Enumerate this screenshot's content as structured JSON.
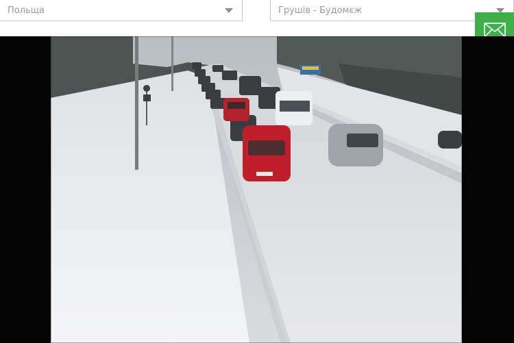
{
  "filters": {
    "country": {
      "value": "Польща",
      "icon": "chevron-down-icon"
    },
    "crossing": {
      "value": "Грушів - Будомєж",
      "icon": "chevron-down-icon"
    }
  },
  "actions": {
    "mail": {
      "icon": "envelope-icon",
      "color": "#3eb049"
    }
  },
  "camera": {
    "content": "Live webcam view of a snowy road with a queue of cars at the border crossing"
  },
  "colors": {
    "accent": "#3eb049",
    "frame_bg": "#030303",
    "placeholder_text": "#9a9a9a"
  }
}
